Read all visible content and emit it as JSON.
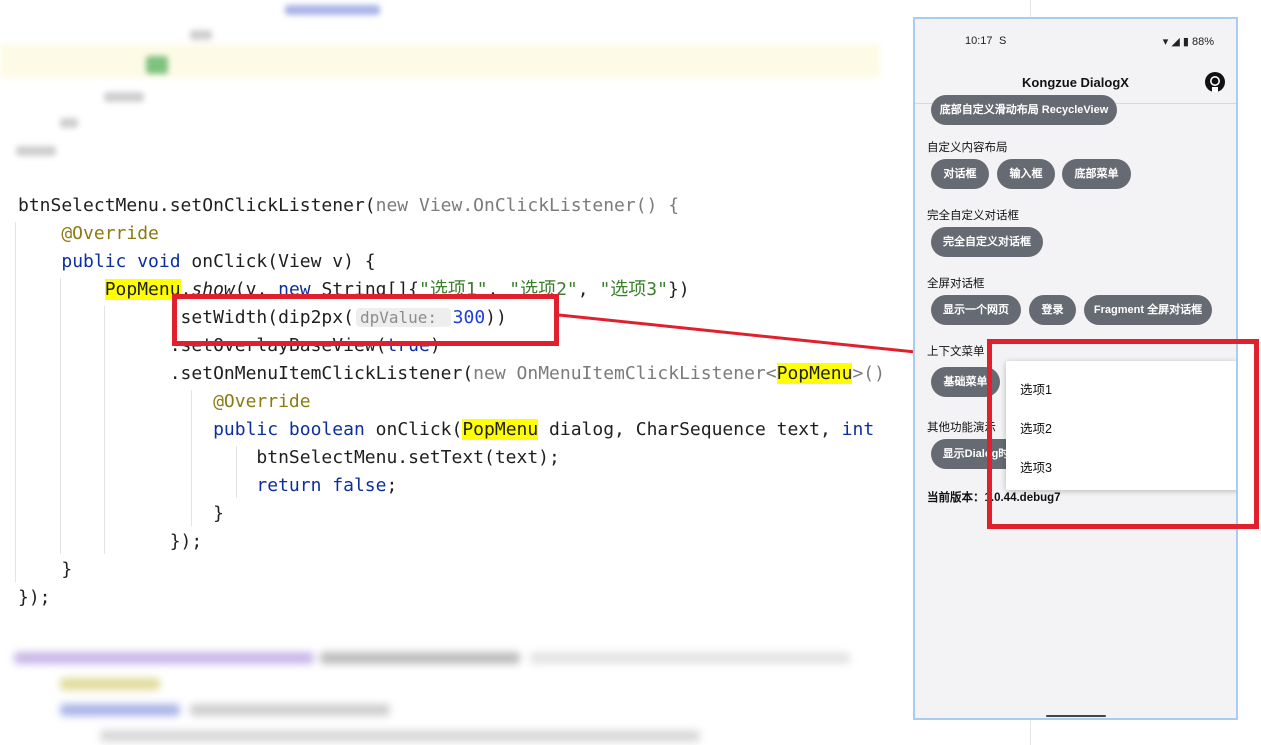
{
  "editor": {
    "lines": [
      {
        "segments": [
          {
            "t": "btnSelectMenu.setOnClickListener(",
            "c": ""
          },
          {
            "t": "new ",
            "c": "kw2"
          },
          {
            "t": "View.OnClickListener() {",
            "c": "kw2"
          }
        ]
      },
      {
        "segments": [
          {
            "t": "    @Override",
            "c": "ann"
          }
        ]
      },
      {
        "segments": [
          {
            "t": "    ",
            "c": ""
          },
          {
            "t": "public void ",
            "c": "kw"
          },
          {
            "t": "onClick(View v) {",
            "c": ""
          }
        ]
      },
      {
        "segments": [
          {
            "t": "        ",
            "c": ""
          },
          {
            "t": "PopMenu",
            "c": "mark"
          },
          {
            "t": ".",
            "c": ""
          },
          {
            "t": "show",
            "c": "ital"
          },
          {
            "t": "(v, ",
            "c": ""
          },
          {
            "t": "new ",
            "c": "kw"
          },
          {
            "t": "String[]{",
            "c": ""
          },
          {
            "t": "\"选项1\"",
            "c": "str"
          },
          {
            "t": ", ",
            "c": ""
          },
          {
            "t": "\"选项2\"",
            "c": "str"
          },
          {
            "t": ", ",
            "c": ""
          },
          {
            "t": "\"选项3\"",
            "c": "str"
          },
          {
            "t": "})",
            "c": ""
          }
        ]
      },
      {
        "segments": [
          {
            "t": "              .setWidth(dip2px(",
            "c": ""
          },
          {
            "t": "dpValue: ",
            "c": "hint"
          },
          {
            "t": "300",
            "c": "num"
          },
          {
            "t": "))",
            "c": ""
          }
        ]
      },
      {
        "segments": [
          {
            "t": "              .setOverlayBaseView(",
            "c": ""
          },
          {
            "t": "true",
            "c": "kw"
          },
          {
            "t": ")",
            "c": ""
          }
        ]
      },
      {
        "segments": [
          {
            "t": "              .setOnMenuItemClickListener(",
            "c": ""
          },
          {
            "t": "new ",
            "c": "kw2"
          },
          {
            "t": "OnMenuItemClickListener<",
            "c": "kw2"
          },
          {
            "t": "PopMenu",
            "c": "mark"
          },
          {
            "t": ">()",
            "c": "kw2"
          }
        ]
      },
      {
        "segments": [
          {
            "t": "                  @Override",
            "c": "ann"
          }
        ]
      },
      {
        "segments": [
          {
            "t": "                  ",
            "c": ""
          },
          {
            "t": "public boolean ",
            "c": "kw"
          },
          {
            "t": "onClick(",
            "c": ""
          },
          {
            "t": "PopMenu",
            "c": "mark"
          },
          {
            "t": " dialog, CharSequence text, ",
            "c": ""
          },
          {
            "t": "int",
            "c": "kw"
          }
        ]
      },
      {
        "segments": [
          {
            "t": "                      btnSelectMenu.setText(text);",
            "c": ""
          }
        ]
      },
      {
        "segments": [
          {
            "t": "                      ",
            "c": ""
          },
          {
            "t": "return false",
            "c": "kw"
          },
          {
            "t": ";",
            "c": ""
          }
        ]
      },
      {
        "segments": [
          {
            "t": "                  }",
            "c": ""
          }
        ]
      },
      {
        "segments": [
          {
            "t": "              });",
            "c": ""
          }
        ]
      },
      {
        "segments": [
          {
            "t": "    }",
            "c": ""
          }
        ]
      },
      {
        "segments": [
          {
            "t": "});",
            "c": ""
          }
        ]
      }
    ]
  },
  "phone": {
    "status": {
      "time": "10:17",
      "sim_icon": "S",
      "battery": "88%"
    },
    "app_title": "Kongzue DialogX",
    "github_icon": "github-icon",
    "partial_button": "底部自定义滑动布局 RecycleView",
    "sections": [
      {
        "title": "自定义内容布局",
        "buttons": [
          "对话框",
          "输入框",
          "底部菜单"
        ]
      },
      {
        "title": "完全自定义对话框",
        "buttons": [
          "完全自定义对话框"
        ]
      },
      {
        "title": "全屏对话框",
        "buttons": [
          "显示一个网页",
          "登录",
          "Fragment 全屏对话框"
        ]
      },
      {
        "title": "上下文菜单",
        "buttons": [
          "基础菜单"
        ]
      },
      {
        "title": "其他功能演示",
        "buttons": [
          "显示Dialog时"
        ]
      }
    ],
    "version_label": "当前版本：1.0.44.debug7",
    "popmenu": {
      "items": [
        "选项1",
        "选项2",
        "选项3"
      ]
    }
  },
  "colors": {
    "highlight": "#ffff00",
    "annotation_red": "#e0202c",
    "pill": "#666a72"
  }
}
